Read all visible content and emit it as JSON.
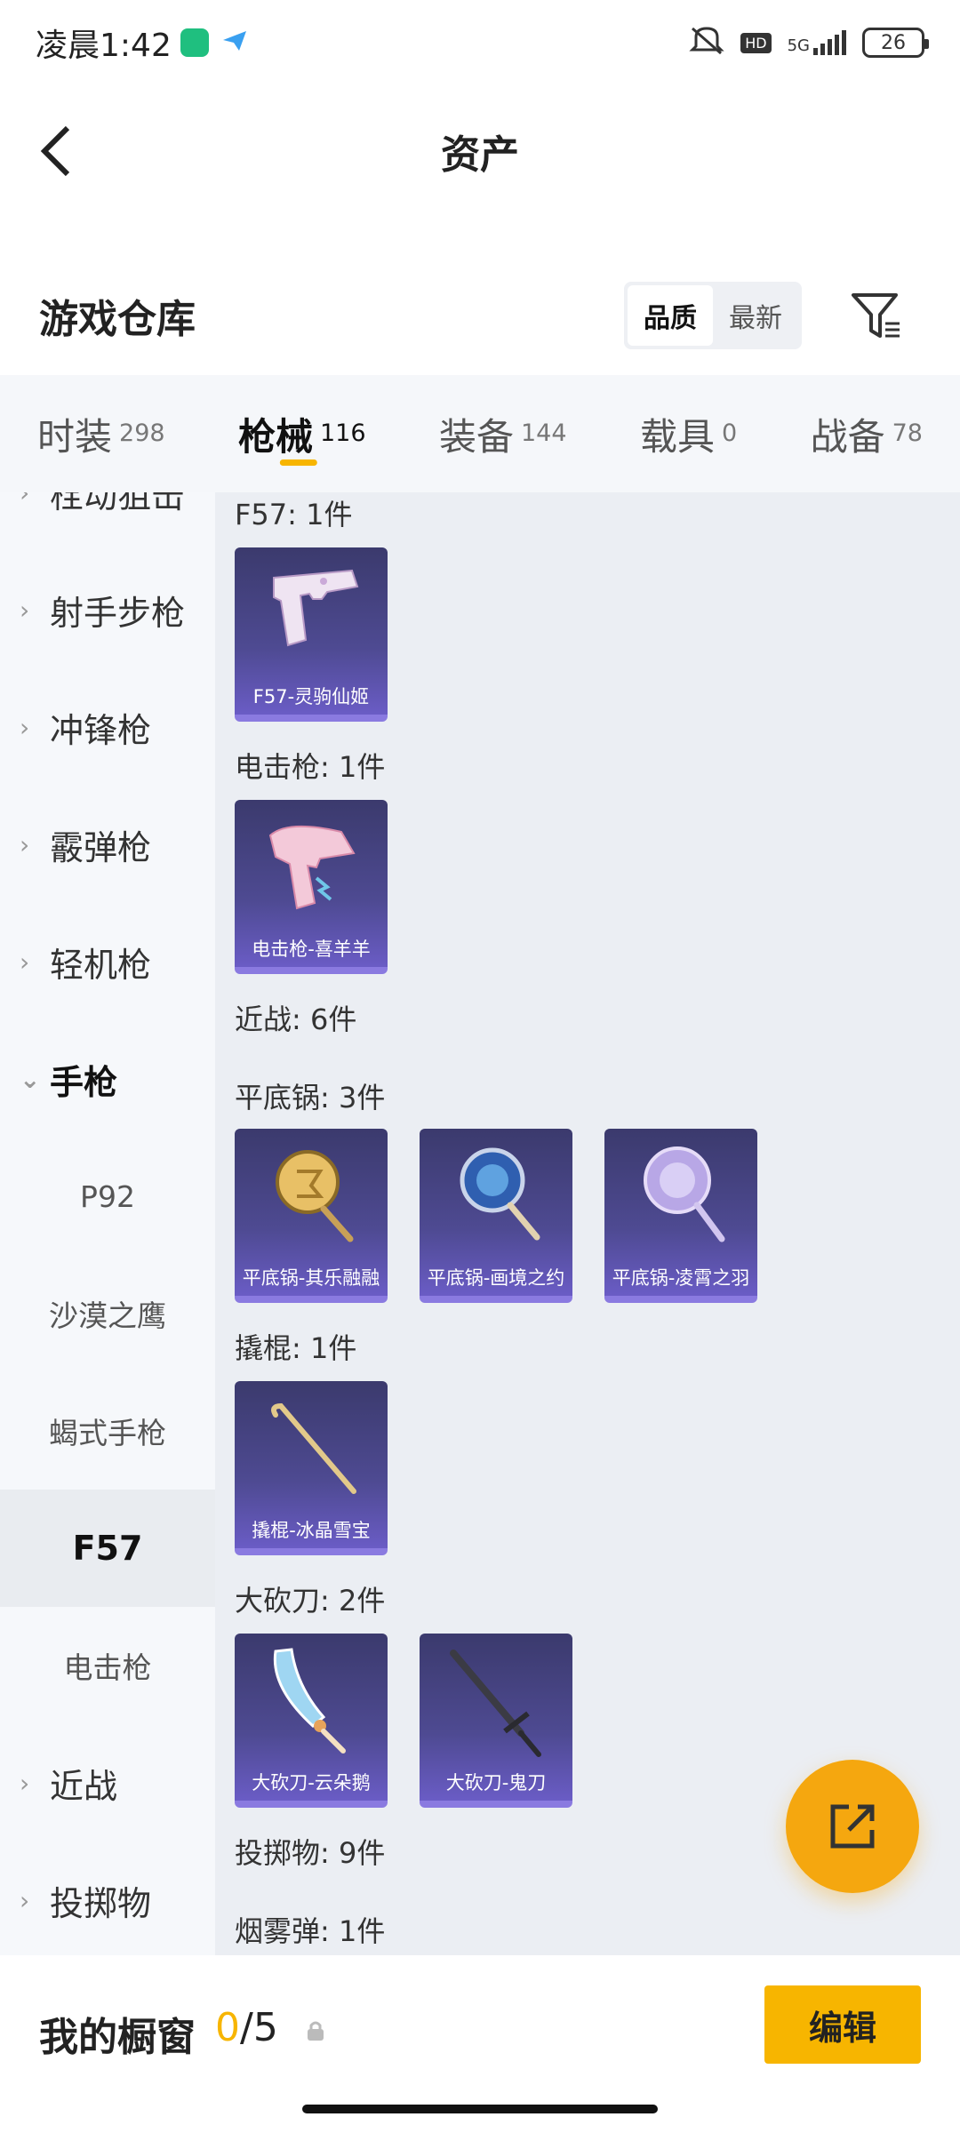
{
  "status_bar": {
    "time": "凌晨1:42",
    "network": "5G",
    "hd": "HD",
    "battery": "26"
  },
  "header": {
    "title": "资产"
  },
  "warehouse": {
    "title": "游戏仓库",
    "sort_options": [
      "品质",
      "最新"
    ],
    "sort_selected": "品质"
  },
  "tabs": [
    {
      "label": "时装",
      "count": "298"
    },
    {
      "label": "枪械",
      "count": "116"
    },
    {
      "label": "装备",
      "count": "144"
    },
    {
      "label": "载具",
      "count": "0"
    },
    {
      "label": "战备",
      "count": "78"
    }
  ],
  "active_tab": "枪械",
  "sidenav": {
    "items": [
      {
        "label": "栓动狙击",
        "type": "parent"
      },
      {
        "label": "射手步枪",
        "type": "parent"
      },
      {
        "label": "冲锋枪",
        "type": "parent"
      },
      {
        "label": "霰弹枪",
        "type": "parent"
      },
      {
        "label": "轻机枪",
        "type": "parent"
      },
      {
        "label": "手枪",
        "type": "parent-expanded"
      },
      {
        "label": "P92",
        "type": "child"
      },
      {
        "label": "沙漠之鹰",
        "type": "child"
      },
      {
        "label": "蝎式手枪",
        "type": "child"
      },
      {
        "label": "F57",
        "type": "child-selected"
      },
      {
        "label": "电击枪",
        "type": "child"
      },
      {
        "label": "近战",
        "type": "parent"
      },
      {
        "label": "投掷物",
        "type": "parent"
      }
    ]
  },
  "groups": [
    {
      "label": "F57: 1件",
      "items": [
        {
          "caption": "F57-灵驹仙姬",
          "icon": "pistol-icon"
        }
      ]
    },
    {
      "label": "电击枪: 1件",
      "items": [
        {
          "caption": "电击枪-喜羊羊",
          "icon": "stun-gun-icon"
        }
      ]
    },
    {
      "label": "近战: 6件",
      "items": []
    },
    {
      "label": "平底锅: 3件",
      "items": [
        {
          "caption": "平底锅-其乐融融",
          "icon": "pan-icon"
        },
        {
          "caption": "平底锅-画境之约",
          "icon": "pan-icon"
        },
        {
          "caption": "平底锅-凌霄之羽",
          "icon": "pan-icon"
        }
      ]
    },
    {
      "label": "撬棍: 1件",
      "items": [
        {
          "caption": "撬棍-冰晶雪宝",
          "icon": "crowbar-icon"
        }
      ]
    },
    {
      "label": "大砍刀: 2件",
      "items": [
        {
          "caption": "大砍刀-云朵鹅",
          "icon": "machete-icon"
        },
        {
          "caption": "大砍刀-鬼刀",
          "icon": "sword-icon"
        }
      ]
    },
    {
      "label": "投掷物: 9件",
      "items": []
    },
    {
      "label": "烟雾弹: 1件",
      "items": []
    }
  ],
  "showcase": {
    "title": "我的橱窗",
    "used": "0",
    "separator_total": "/5",
    "edit_label": "编辑"
  },
  "colors": {
    "accent": "#f7b500",
    "card_bg": "#4e4a92",
    "fab": "#f5a70f"
  }
}
